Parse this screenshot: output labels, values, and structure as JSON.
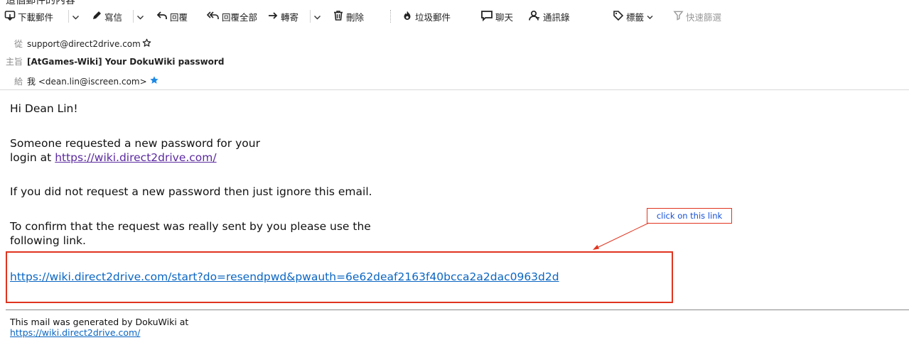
{
  "top_strip_text": "這個郵件的內容",
  "toolbar": {
    "download": "下載郵件",
    "write": "寫信",
    "reply": "回覆",
    "reply_all": "回覆全部",
    "forward": "轉寄",
    "delete": "刪除",
    "junk": "垃圾郵件",
    "chat": "聊天",
    "contacts": "通訊錄",
    "tags": "標籤",
    "quick_filter": "快速篩選"
  },
  "headers": {
    "from_label": "從",
    "from_value": "support@direct2drive.com",
    "subject_label": "主旨",
    "subject_value": "[AtGames-Wiki] Your DokuWiki password",
    "to_label": "給",
    "to_value": "我 <dean.lin@iscreen.com>"
  },
  "message": {
    "greeting": "Hi Dean Lin!",
    "p1_line1": "Someone requested a new password for your",
    "p1_line2_prefix": "login at ",
    "p1_link": "https://wiki.direct2drive.com/",
    "p2": "If you did not request a new password then just ignore this email.",
    "p3_line1": "To confirm that the request was really sent by you please use the",
    "p3_line2": "following link.",
    "reset_link": "https://wiki.direct2drive.com/start?do=resendpwd&pwauth=6e62deaf2163f40bcca2a2dac0963d2d"
  },
  "annotation": {
    "note": "click on this link",
    "color": "#e0341f",
    "note_text_color": "#1550d8"
  },
  "footer": {
    "line1": "This mail was generated by DokuWiki at",
    "link": "https://wiki.direct2drive.com/"
  },
  "colors": {
    "link": "#0b66c3",
    "visited_link": "#5b2aa0",
    "star_active": "#1e88e5"
  }
}
